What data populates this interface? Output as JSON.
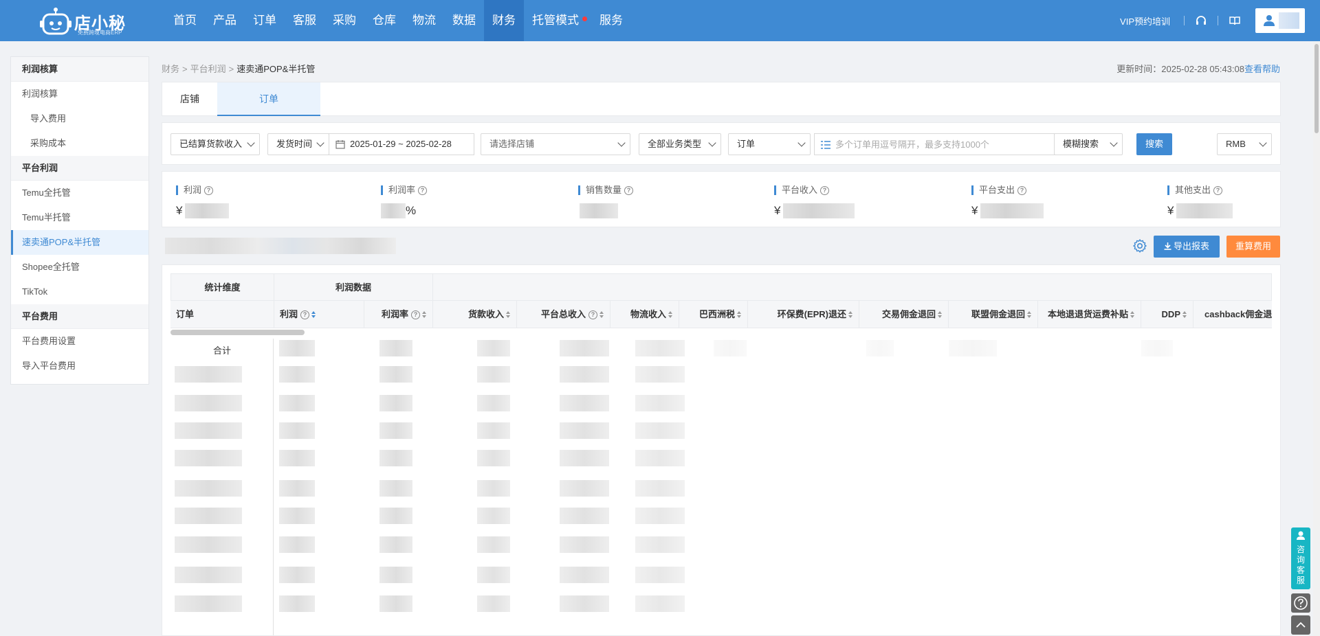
{
  "brand": {
    "name": "店小秘",
    "subtitle": "免费跨境电商ERP"
  },
  "nav": {
    "items": [
      {
        "label": "首页"
      },
      {
        "label": "产品"
      },
      {
        "label": "订单"
      },
      {
        "label": "客服"
      },
      {
        "label": "采购"
      },
      {
        "label": "仓库"
      },
      {
        "label": "物流"
      },
      {
        "label": "数据"
      },
      {
        "label": "财务",
        "active": true
      },
      {
        "label": "托管模式",
        "dot": true
      },
      {
        "label": "服务"
      }
    ],
    "vip": "VIP预约培训",
    "headset_icon": "headset-icon",
    "book_icon": "book-icon"
  },
  "sidebar": {
    "groups": [
      {
        "title": "利润核算",
        "items": [
          {
            "label": "利润核算"
          },
          {
            "label": "导入费用",
            "sub": true
          },
          {
            "label": "采购成本",
            "sub": true
          }
        ]
      },
      {
        "title": "平台利润",
        "items": [
          {
            "label": "Temu全托管"
          },
          {
            "label": "Temu半托管"
          },
          {
            "label": "速卖通POP&半托管",
            "active": true
          },
          {
            "label": "Shopee全托管"
          },
          {
            "label": "TikTok"
          }
        ]
      },
      {
        "title": "平台费用",
        "items": [
          {
            "label": "平台费用设置"
          },
          {
            "label": "导入平台费用"
          }
        ]
      }
    ]
  },
  "breadcrumb": {
    "l1": "财务",
    "l2": "平台利润",
    "l3": "速卖通POP&半托管",
    "sep": ">"
  },
  "update": {
    "label": "更新时间：",
    "time": "2025-02-28 05:43:08",
    "help": "查看帮助"
  },
  "tabs": {
    "shop": "店铺",
    "order": "订单"
  },
  "filters": {
    "income_type": "已结算货款收入",
    "time_type": "发货时间",
    "date_range": "2025-01-29 ~ 2025-02-28",
    "shop_placeholder": "请选择店铺",
    "biz_type": "全部业务类型",
    "search_type": "订单",
    "search_placeholder": "多个订单用逗号隔开，最多支持1000个",
    "match_mode": "模糊搜索",
    "search_btn": "搜索",
    "currency": "RMB"
  },
  "stats": [
    {
      "label": "利润",
      "prefix": "¥",
      "suffix": ""
    },
    {
      "label": "利润率",
      "prefix": "",
      "suffix": "%"
    },
    {
      "label": "销售数量",
      "prefix": "",
      "suffix": ""
    },
    {
      "label": "平台收入",
      "prefix": "¥",
      "suffix": ""
    },
    {
      "label": "平台支出",
      "prefix": "¥",
      "suffix": ""
    },
    {
      "label": "其他支出",
      "prefix": "¥",
      "suffix": ""
    }
  ],
  "actions": {
    "export": "导出报表",
    "recalc": "重算费用"
  },
  "table": {
    "group_headers": {
      "dimension": "统计维度",
      "profit_data": "利润数据"
    },
    "columns": [
      {
        "label": "订单"
      },
      {
        "label": "利润",
        "help": true,
        "sort": "on"
      },
      {
        "label": "利润率",
        "help": true,
        "sort": "off"
      },
      {
        "label": "货款收入",
        "sort": "off"
      },
      {
        "label": "平台总收入",
        "help": true,
        "sort": "off"
      },
      {
        "label": "物流收入",
        "sort": "off"
      },
      {
        "label": "巴西洲税",
        "sort": "off"
      },
      {
        "label": "环保费(EPR)退还",
        "sort": "off"
      },
      {
        "label": "交易佣金退回",
        "sort": "off"
      },
      {
        "label": "联盟佣金退回",
        "sort": "off"
      },
      {
        "label": "本地退退货运费补贴",
        "sort": "off"
      },
      {
        "label": "DDP",
        "sort": "off"
      },
      {
        "label": "cashback佣金退",
        "sort": "off"
      }
    ],
    "total_label": "合计"
  },
  "float": {
    "cs_label": "咨询客服"
  }
}
